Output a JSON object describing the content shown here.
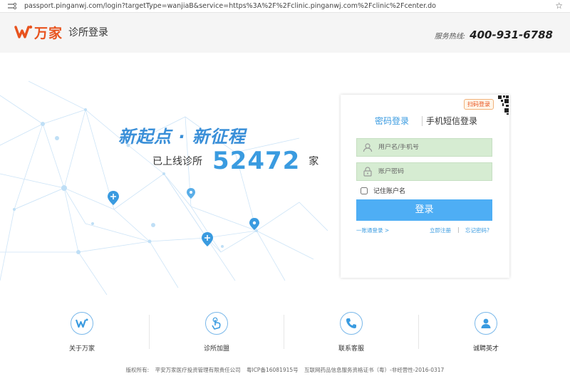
{
  "browser": {
    "url": "passport.pinganwj.com/login?targetType=wanjiaB&service=https%3A%2F%2Fclinic.pinganwj.com%2Fclinic%2Fcenter.do",
    "icons": [
      "site-info-icon",
      "bookmark-star-icon"
    ]
  },
  "header": {
    "brand": "万家",
    "subtitle": "诊所登录",
    "hotline_label": "服务热线:",
    "hotline_number": "400-931-6788"
  },
  "hero": {
    "slogan": "新起点 · 新征程",
    "count_prefix": "已上线诊所",
    "count_value": "52472",
    "count_suffix": "家"
  },
  "login": {
    "qr_badge": "扫码登录",
    "tabs": [
      {
        "label": "密码登录",
        "active": true
      },
      {
        "label": "手机短信登录",
        "active": false
      }
    ],
    "username_placeholder": "用户名/手机号",
    "password_placeholder": "账户密码",
    "remember_label": "记住账户名",
    "submit_label": "登录",
    "link_general": "一账通登录 >",
    "link_register": "立即注册",
    "link_separator": "|",
    "link_forgot": "忘记密码?"
  },
  "features": [
    {
      "label": "关于万家",
      "icon": "wanjia-logo-icon"
    },
    {
      "label": "诊所加盟",
      "icon": "hand-tap-icon"
    },
    {
      "label": "联系客服",
      "icon": "phone-icon"
    },
    {
      "label": "诚聘英才",
      "icon": "person-icon"
    }
  ],
  "footer": {
    "copyright_label": "版权所有:",
    "company": "平安万家医疗投资管理有限责任公司",
    "icp": "粤ICP备16081915号",
    "license": "互联网药品信息服务资格证书（粤）-非经营性-2016-0317"
  },
  "colors": {
    "brand_orange": "#e8531e",
    "accent_blue": "#3a9be0",
    "button_blue": "#4eaef5",
    "field_green": "#d6ecd2"
  }
}
